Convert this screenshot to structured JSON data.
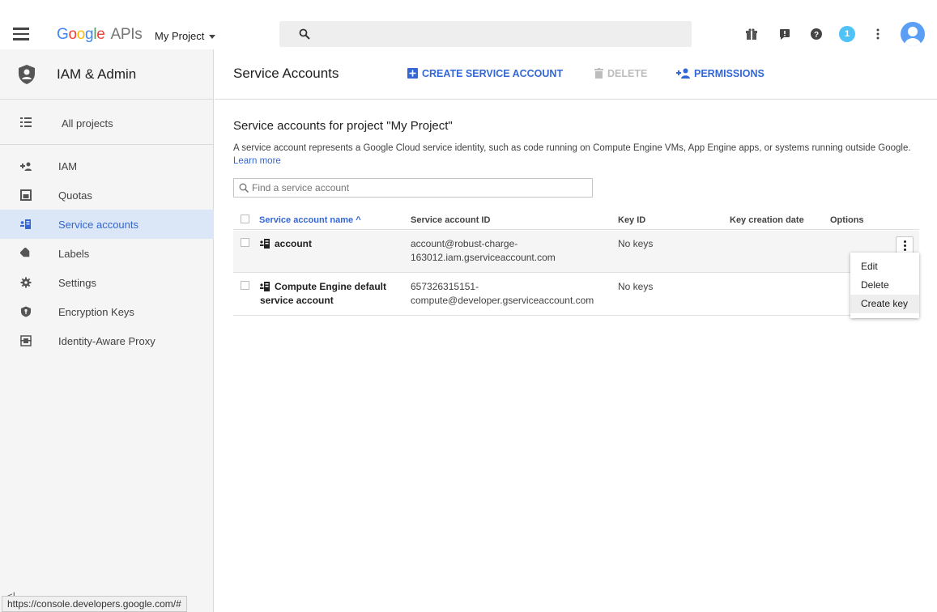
{
  "topbar": {
    "logo_google": "Google",
    "logo_apis": "APIs",
    "project": "My Project",
    "notification_count": "1",
    "icons": [
      "menu-icon",
      "search-icon",
      "gift-icon",
      "feedback-icon",
      "help-icon",
      "notifications-icon",
      "more-vert-icon",
      "account-icon"
    ]
  },
  "sidebar": {
    "title": "IAM & Admin",
    "all_projects": "All projects",
    "items": [
      {
        "label": "IAM",
        "icon": "add-person-icon"
      },
      {
        "label": "Quotas",
        "icon": "quotas-icon"
      },
      {
        "label": "Service accounts",
        "icon": "service-account-icon",
        "active": true
      },
      {
        "label": "Labels",
        "icon": "label-icon"
      },
      {
        "label": "Settings",
        "icon": "settings-icon"
      },
      {
        "label": "Encryption Keys",
        "icon": "key-shield-icon"
      },
      {
        "label": "Identity-Aware Proxy",
        "icon": "proxy-icon"
      }
    ],
    "collapse": "<|"
  },
  "main": {
    "title": "Service Accounts",
    "actions": {
      "create": "CREATE SERVICE ACCOUNT",
      "delete": "DELETE",
      "permissions": "PERMISSIONS"
    },
    "section_title": "Service accounts for project \"My Project\"",
    "description": "A service account represents a Google Cloud service identity, such as code running on Compute Engine VMs, App Engine apps, or systems running outside Google.",
    "learn_more": "Learn more",
    "filter_placeholder": "Find a service account",
    "columns": [
      "Service account name ^",
      "Service account ID",
      "Key ID",
      "Key creation date",
      "Options"
    ],
    "rows": [
      {
        "name_line1": "account",
        "name_line2": "",
        "id_line1": "account@robust-charge-",
        "id_line2": "163012.iam.gserviceaccount.com",
        "key_id": "No keys"
      },
      {
        "name_line1": "Compute Engine default",
        "name_line2": "service account",
        "id_line1": "657326315151-",
        "id_line2": "compute@developer.gserviceaccount.com",
        "key_id": "No keys"
      }
    ],
    "menu": [
      "Edit",
      "Delete",
      "Create key"
    ]
  },
  "status_url": "https://console.developers.google.com/#",
  "colors": {
    "accent": "#3367d6",
    "active_bg": "#dbe6f7",
    "sidebar_bg": "#f5f5f5"
  }
}
